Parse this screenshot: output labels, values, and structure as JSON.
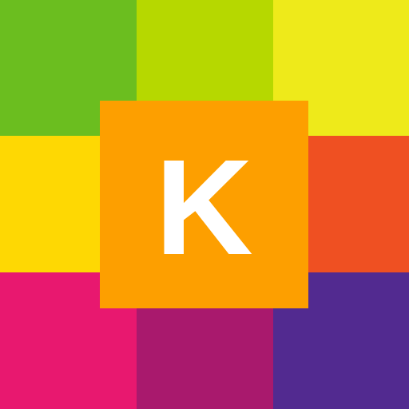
{
  "icon": {
    "letter": "K",
    "letter_color": "#ffffff",
    "center_tile_color": "#fd9f00",
    "tiles": [
      {
        "name": "tile-top-left",
        "color": "#6bbe1f"
      },
      {
        "name": "tile-top-middle",
        "color": "#b6d800"
      },
      {
        "name": "tile-top-right",
        "color": "#eeea1a"
      },
      {
        "name": "tile-middle-left",
        "color": "#fed803"
      },
      {
        "name": "tile-center",
        "color": "#fd9f00"
      },
      {
        "name": "tile-middle-right",
        "color": "#ef5022"
      },
      {
        "name": "tile-bottom-left",
        "color": "#e8186f"
      },
      {
        "name": "tile-bottom-middle",
        "color": "#a9196d"
      },
      {
        "name": "tile-bottom-right",
        "color": "#522a90"
      }
    ]
  }
}
